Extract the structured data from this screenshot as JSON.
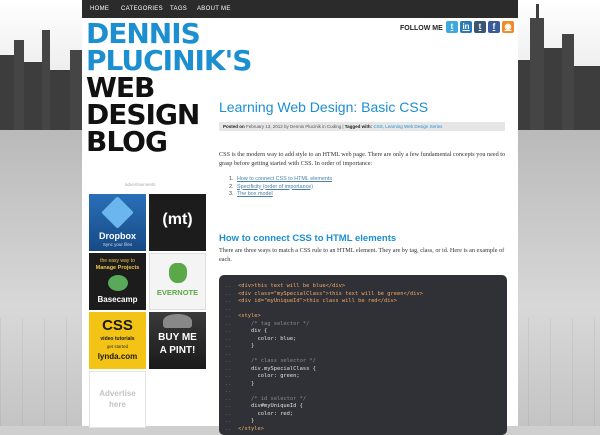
{
  "nav": {
    "items": [
      {
        "label": "HOME"
      },
      {
        "label": "CATEGORIES"
      },
      {
        "label": "TAGS"
      },
      {
        "label": "ABOUT ME"
      }
    ]
  },
  "logo": {
    "lines": [
      "DENNIS",
      "PLUCINIK'S",
      "WEB",
      "DESIGN",
      "BLOG"
    ]
  },
  "social": {
    "label": "FOLLOW ME",
    "icons": [
      {
        "name": "twitter-icon",
        "glyph": "t",
        "color": "#3fa8df"
      },
      {
        "name": "linkedin-icon",
        "glyph": "in",
        "color": "#2a7bb5"
      },
      {
        "name": "tumblr-icon",
        "glyph": "t",
        "color": "#3a5570"
      },
      {
        "name": "facebook-icon",
        "glyph": "f",
        "color": "#3b5a98"
      },
      {
        "name": "rss-icon",
        "glyph": "◉",
        "color": "#f08b2a"
      }
    ]
  },
  "post": {
    "title": "Learning Web Design: Basic CSS",
    "meta": {
      "posted_on": "Posted on",
      "date": "February 13, 2012 by Dennis Plucinik in Coding",
      "tagged": "Tagged with:",
      "tags": "CSS, Learning Web Design Series"
    },
    "intro": "CSS is the modern way to add style to an HTML web page. There are only a few fundamental concepts you need to grasp before getting started with CSS. In order of importance:",
    "toc": [
      {
        "num": "1.",
        "label": "How to connect CSS to HTML elements"
      },
      {
        "num": "2.",
        "label": "Specificity (order of importance)"
      },
      {
        "num": "3.",
        "label": "The box model"
      }
    ],
    "section_heading": "How to connect CSS to HTML elements",
    "section_text": "There are three ways to match a CSS rule to an HTML element. They are by tag, class, or id. Here is an example of each."
  },
  "code": {
    "line_marker": "..",
    "lines": [
      {
        "kind": "tag",
        "text": "<div>this text will be blue</div>"
      },
      {
        "kind": "tag",
        "text": "<div class=\"mySpecialClass\">this text will be green</div>"
      },
      {
        "kind": "tag",
        "text": "<div id=\"myUniqueId\">this class will be red</div>"
      },
      {
        "kind": "blank",
        "text": ""
      },
      {
        "kind": "tag",
        "text": "<style>"
      },
      {
        "kind": "cmt",
        "text": "    /* tag selector */"
      },
      {
        "kind": "code",
        "text": "    div {"
      },
      {
        "kind": "code",
        "text": "      color: blue;"
      },
      {
        "kind": "code",
        "text": "    }"
      },
      {
        "kind": "blank",
        "text": ""
      },
      {
        "kind": "cmt",
        "text": "    /* class selector */"
      },
      {
        "kind": "code",
        "text": "    div.mySpecialClass {"
      },
      {
        "kind": "code",
        "text": "      color: green;"
      },
      {
        "kind": "code",
        "text": "    }"
      },
      {
        "kind": "blank",
        "text": ""
      },
      {
        "kind": "cmt",
        "text": "    /* id selector */"
      },
      {
        "kind": "code",
        "text": "    div#myUniqueId {"
      },
      {
        "kind": "code",
        "text": "      color: red;"
      },
      {
        "kind": "code",
        "text": "    }"
      },
      {
        "kind": "tag",
        "text": "</style>"
      }
    ]
  },
  "ads": {
    "label": "advertisements",
    "dropbox": {
      "title": "Dropbox",
      "subtitle": "Sync your files"
    },
    "mt": {
      "label": "(mt)"
    },
    "basecamp": {
      "top": "the easy way to",
      "top2": "Manage Projects",
      "title": "Basecamp"
    },
    "evernote": {
      "title": "EVERNOTE"
    },
    "lynda": {
      "title": "CSS",
      "sub1": "video tutorials",
      "sub2": "get started",
      "brand": "lynda.com"
    },
    "pint": {
      "line1": "BUY ME",
      "line2": "A PINT!"
    },
    "advertise": {
      "line1": "Advertise",
      "line2": "here"
    }
  }
}
